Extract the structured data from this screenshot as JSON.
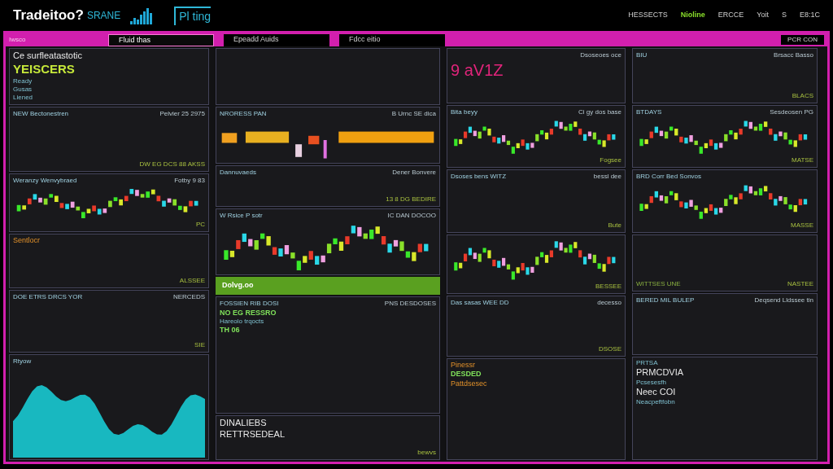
{
  "header": {
    "logo": "Tradeitoo?",
    "logo_suffix": "SRANE",
    "brand": "Pl ting",
    "status": [
      {
        "text": "HESSECTS",
        "kind": "plain"
      },
      {
        "text": "Nioline",
        "kind": "live"
      },
      {
        "text": "ERCCE",
        "kind": "plain"
      },
      {
        "text": "Yoit",
        "kind": "plain"
      },
      {
        "text": "S",
        "kind": "plain"
      },
      {
        "text": "E8:1C",
        "kind": "plain"
      }
    ]
  },
  "tab_bar": {
    "label": "Iwsco",
    "tabs": [
      {
        "label": "Fluid thas",
        "selected": true
      },
      {
        "label": "Epeadd Auids",
        "selected": false
      },
      {
        "label": "Fdcc eitio",
        "selected": false
      }
    ],
    "right": "PCR CON"
  },
  "columns": [
    {
      "panels": [
        {
          "kind": "panel",
          "lines": [
            {
              "text": "Ce surfleatastotic",
              "kind": "headline"
            },
            {
              "text": "YEISCERS",
              "kind": "accent"
            },
            {
              "text": "Ready",
              "kind": "label"
            },
            {
              "text": "Gusas",
              "kind": "label"
            },
            {
              "text": "Liened",
              "kind": "label"
            }
          ]
        },
        {
          "kind": "panel",
          "title": "NEW Bectonestren",
          "right": "Pelvier 25 2975",
          "footer_right": "DW EG DCS 88 AKSS"
        },
        {
          "kind": "panel",
          "title": "Weranzy Wenvybraed",
          "right": "Fotby 9 83",
          "graphic": {
            "kind": "candles"
          },
          "footer_right": "PC"
        },
        {
          "kind": "panel",
          "lines": [
            {
              "text": "Sentlocr",
              "kind": "warm"
            }
          ],
          "footer_right": "ALSSEE"
        },
        {
          "kind": "panel",
          "title": "DOE ETRS DRCS YOR",
          "right": "NERCEDS",
          "footer_right": "SIE"
        },
        {
          "kind": "panel",
          "title": "Rtyow",
          "graphic": {
            "kind": "wave"
          }
        }
      ]
    },
    {
      "panels": [
        {
          "kind": "panel"
        },
        {
          "kind": "panel",
          "title": "NRORESS PAN",
          "right": "B Urnc  SE dica",
          "graphic": {
            "kind": "bars"
          }
        },
        {
          "kind": "panel",
          "title": "Dannuvaeds",
          "right": "Dener Bonvere",
          "footer_right": "13 8 DG BEDIRE"
        },
        {
          "kind": "panel",
          "title": "W Rsice P sotr",
          "right": "IC DAN DOCOO",
          "graphic": {
            "kind": "candles"
          }
        },
        {
          "kind": "banner",
          "title": "Dolvg.oo"
        },
        {
          "kind": "panel",
          "title": "FOSSIEN RIB DOSI",
          "right": "PNS DESDOSES",
          "lines": [
            {
              "text": "NO EG RESSRO",
              "kind": "value"
            },
            {
              "text": "Hareolo trqocts",
              "kind": "label"
            },
            {
              "text": "TH 06",
              "kind": "value"
            }
          ]
        },
        {
          "kind": "panel",
          "lines": [
            {
              "text": "DINALIEBS",
              "kind": "headline"
            },
            {
              "text": "RETTRSEDEAL",
              "kind": "headline"
            }
          ],
          "footer_right": "bewvs"
        }
      ]
    },
    {
      "panels": [
        {
          "kind": "panel",
          "right": "Dsoseoes oce",
          "lines": [
            {
              "text": "9 aV1Z",
              "kind": "hot"
            }
          ]
        },
        {
          "kind": "panel",
          "title": "Bita beyy",
          "right": "Ci gy dos base",
          "graphic": {
            "kind": "candles"
          },
          "footer_right": "Fogsee"
        },
        {
          "kind": "panel",
          "title": "Dsoses bens WITZ",
          "right": "bessl dee",
          "footer_right": "Bute"
        },
        {
          "kind": "panel",
          "graphic": {
            "kind": "candles"
          },
          "footer_right": "BESSEE"
        },
        {
          "kind": "panel",
          "title": "Das sasas WEE DD",
          "right": "decesso",
          "footer_right": "DSOSE"
        },
        {
          "kind": "panel",
          "lines": [
            {
              "text": "Pinessr",
              "kind": "warm"
            },
            {
              "text": "DESDED",
              "kind": "value"
            },
            {
              "text": "Pattdsesec",
              "kind": "warm"
            }
          ]
        }
      ]
    },
    {
      "panels": [
        {
          "kind": "panel",
          "title": "BIU",
          "right": "Brsacc Basso",
          "footer_right": "BLACS"
        },
        {
          "kind": "panel",
          "title": "BTDAYS",
          "right": "Sesdeosen PG",
          "graphic": {
            "kind": "candles"
          },
          "footer_right": "MATSE"
        },
        {
          "kind": "panel",
          "title": "BRD Corr Bed Sonvos",
          "graphic": {
            "kind": "candles"
          },
          "footer_right": "MASSE"
        },
        {
          "kind": "panel",
          "footer_left": "WITTSES UNE",
          "footer_right": "NASTEE"
        },
        {
          "kind": "panel",
          "title": "BERED  MIL BULEP",
          "right": "Deqsend Lldssee tin"
        },
        {
          "kind": "panel",
          "lines": [
            {
              "text": "PRTSA",
              "kind": "label"
            },
            {
              "text": "PRMCDVIA",
              "kind": "headline"
            },
            {
              "text": "Pcsesesfh",
              "kind": "label"
            },
            {
              "text": "Neec COI",
              "kind": "headline"
            },
            {
              "text": "Neacpeftfobn",
              "kind": "label"
            }
          ]
        }
      ]
    }
  ]
}
